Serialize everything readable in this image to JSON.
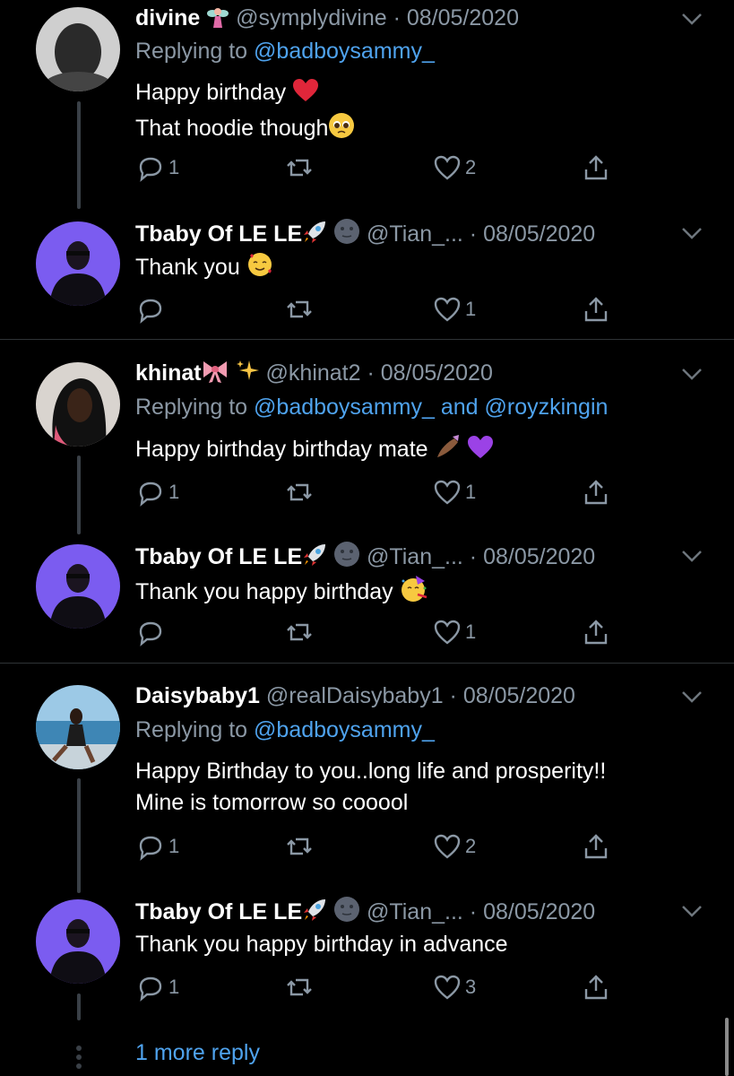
{
  "tweets": [
    {
      "name": "divine",
      "handle": "@symplydivine · 08/05/2020",
      "replying_prefix": "Replying to ",
      "replying_to": "@badboysammy_",
      "lines": [
        "Happy birthday",
        "That hoodie though"
      ],
      "reply_count": "1",
      "like_count": "2"
    },
    {
      "name": "Tbaby Of LE LE",
      "handle": "@Tian_... · 08/05/2020",
      "lines": [
        "Thank you"
      ],
      "reply_count": "",
      "like_count": "1"
    },
    {
      "name": "khinat",
      "handle": "@khinat2 · 08/05/2020",
      "replying_prefix": "Replying to ",
      "replying_to": "@badboysammy_ and @royzkingin",
      "lines": [
        "Happy birthday birthday mate"
      ],
      "reply_count": "1",
      "like_count": "1"
    },
    {
      "name": "Tbaby Of LE LE",
      "handle": "@Tian_... · 08/05/2020",
      "lines": [
        "Thank you happy birthday"
      ],
      "reply_count": "",
      "like_count": "1"
    },
    {
      "name": "Daisybaby1",
      "handle": "@realDaisybaby1 · 08/05/2020",
      "replying_prefix": "Replying to ",
      "replying_to": "@badboysammy_",
      "lines": [
        "Happy Birthday to you..long life and prosperity!!",
        "Mine is tomorrow so cooool"
      ],
      "reply_count": "1",
      "like_count": "2"
    },
    {
      "name": "Tbaby Of LE LE",
      "handle": "@Tian_... · 08/05/2020",
      "lines": [
        "Thank you happy birthday in advance"
      ],
      "reply_count": "1",
      "like_count": "3"
    }
  ],
  "more_replies": "1 more reply",
  "colors": {
    "background": "#000000",
    "secondary": "#8b98a5",
    "link": "#4fa3ee",
    "avatar_purple": "#7b5cf0"
  }
}
